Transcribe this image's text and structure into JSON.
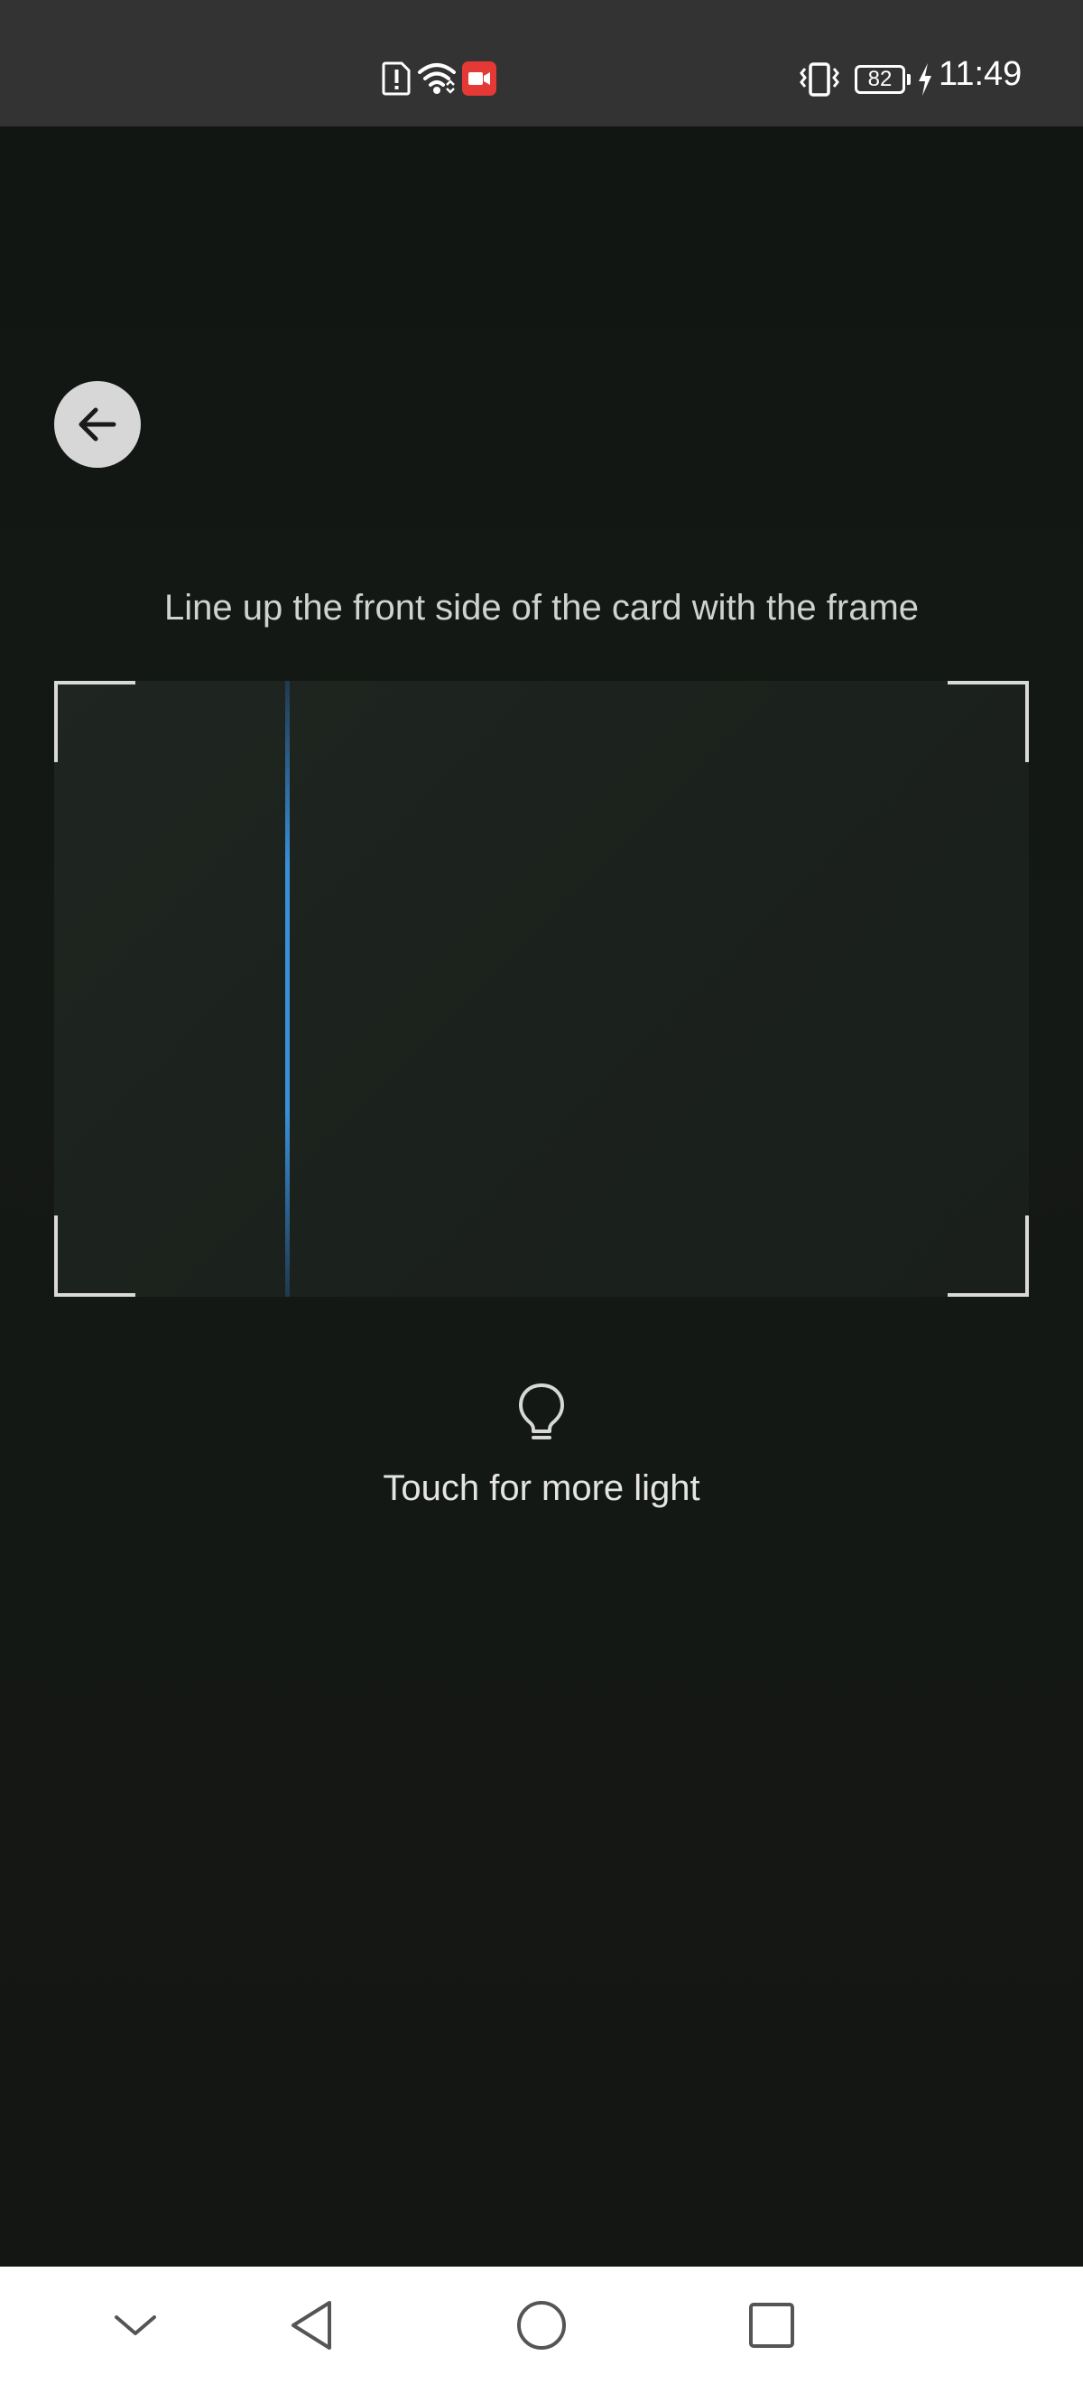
{
  "status_bar": {
    "time": "11:49",
    "battery_level": "82",
    "left_icons": [
      "alert-icon",
      "wifi-icon",
      "screen-record-icon"
    ],
    "right_icons": [
      "vibrate-icon",
      "battery-icon",
      "charging-icon"
    ],
    "record_color": "#e53935"
  },
  "scanner": {
    "back_icon": "arrow-left-icon",
    "instruction": "Line up the front side of the card with the frame",
    "scan_line_color": "#3a8fd8",
    "light_hint": "Touch for more light",
    "light_icon": "lightbulb-icon"
  },
  "nav_bar": {
    "buttons": [
      "chevron-down-icon",
      "back-triangle-icon",
      "home-circle-icon",
      "recents-square-icon"
    ]
  }
}
